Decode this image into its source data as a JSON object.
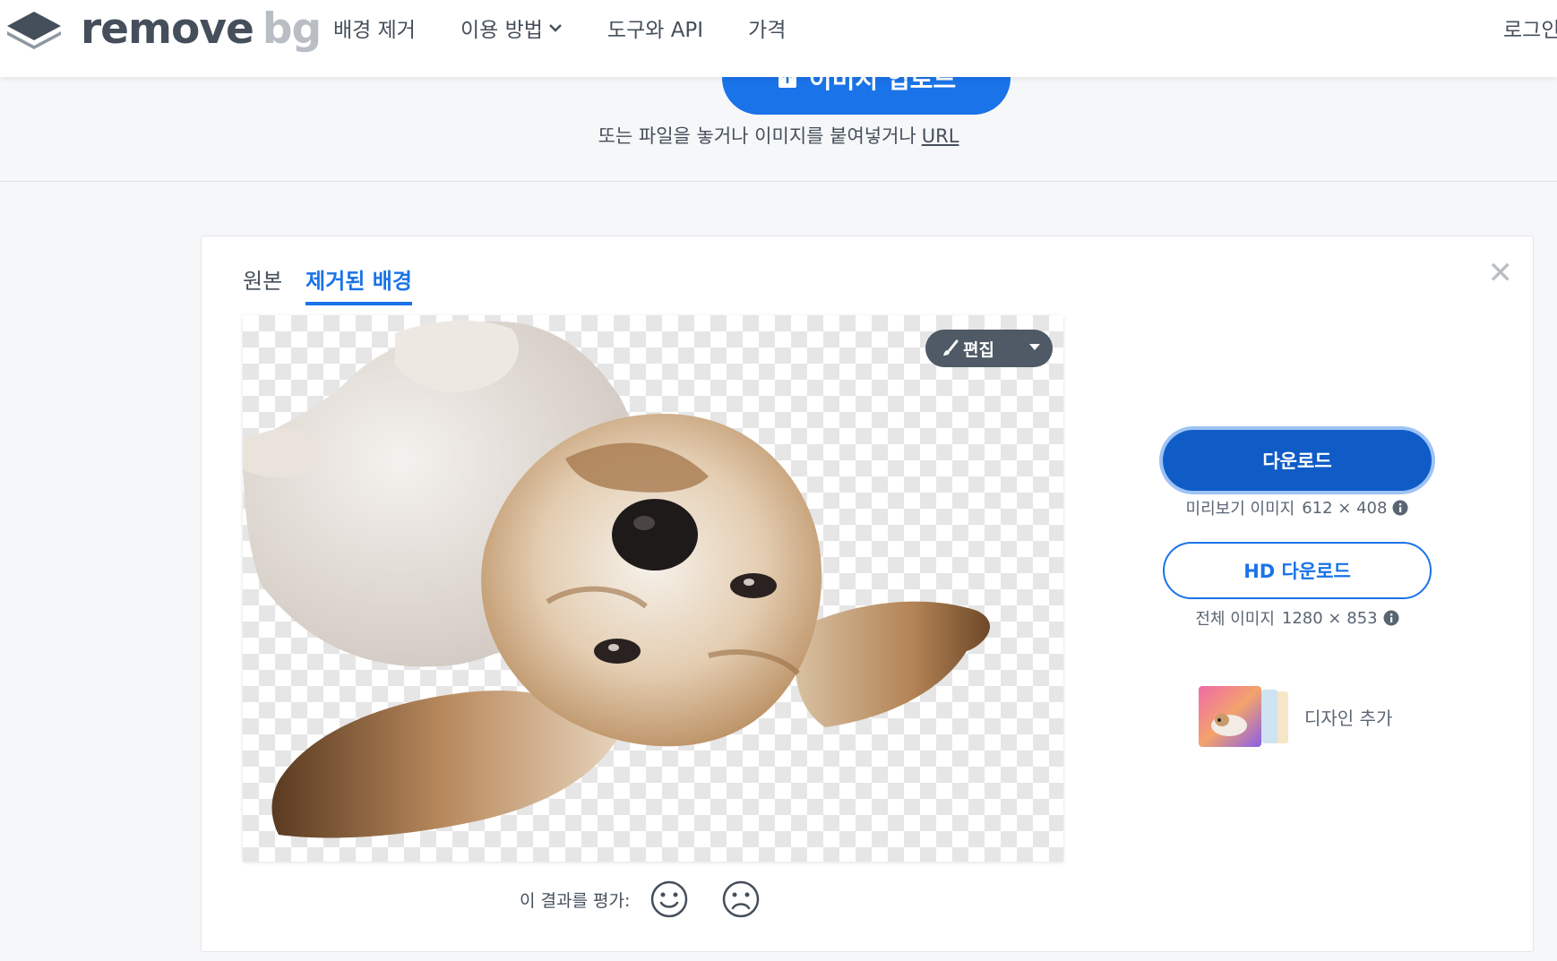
{
  "brand": {
    "word1": "remove",
    "word2": "bg"
  },
  "nav": {
    "items": [
      {
        "label": "배경 제거"
      },
      {
        "label": "이용 방법",
        "has_dropdown": true
      },
      {
        "label": "도구와 API"
      },
      {
        "label": "가격"
      }
    ],
    "login_label": "로그인"
  },
  "upload": {
    "button_label": "이미지 업로드",
    "hint": "또는 파일을 놓거나 이미지를 붙여넣거나",
    "url_label": "URL"
  },
  "result": {
    "tabs": [
      {
        "label": "원본",
        "active": false
      },
      {
        "label": "제거된 배경",
        "active": true
      }
    ],
    "close_label": "✕",
    "edit_label": "편집",
    "rating_label": "이 결과를 평가:",
    "download": {
      "label": "다운로드",
      "info_label": "미리보기 이미지",
      "info_size": "612 × 408"
    },
    "hd_download": {
      "label": "HD 다운로드",
      "info_label": "전체 이미지",
      "info_size": "1280 × 853"
    },
    "design_label": "디자인 추가"
  },
  "colors": {
    "accent": "#1a73e8",
    "download_button": "#0f5cc7",
    "text": "#454f5b",
    "edit_button": "#4f5a66"
  },
  "icons": [
    "logo-layers-icon",
    "chevron-down-icon",
    "upload-icon",
    "close-icon",
    "brush-icon",
    "caret-down-icon",
    "info-icon",
    "smile-icon",
    "frown-icon"
  ]
}
